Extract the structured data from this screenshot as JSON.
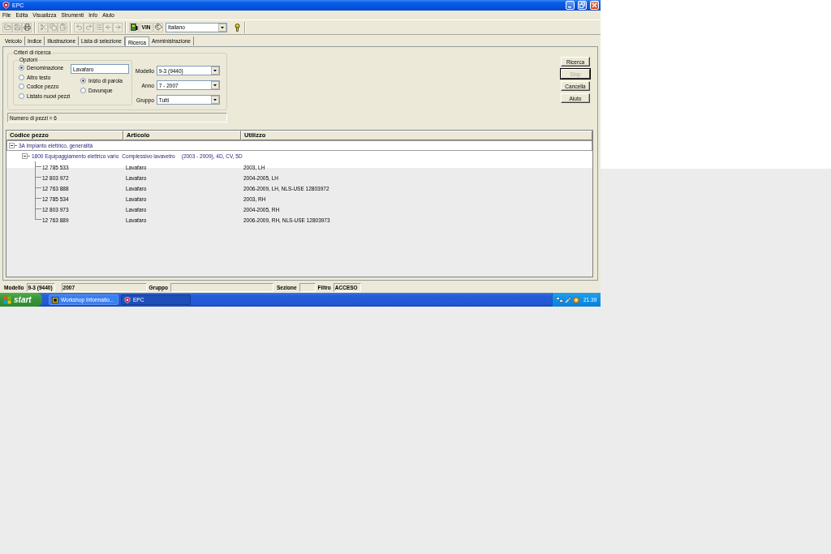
{
  "window": {
    "title": "EPC"
  },
  "menu": [
    "File",
    "Edita",
    "Visualizza",
    "Strumenti",
    "Info",
    "Aiuto"
  ],
  "toolbar": {
    "vin_label": "VIN",
    "language": "Italiano"
  },
  "tabs": [
    {
      "label": "Veicolo",
      "selected": false
    },
    {
      "label": "Indice",
      "selected": false
    },
    {
      "label": "Illustrazione",
      "selected": false
    },
    {
      "label": "Lista di selezione",
      "selected": false
    },
    {
      "label": "Ricerca",
      "selected": true
    },
    {
      "label": "Amministrazione",
      "selected": false
    }
  ],
  "search_criteria": {
    "title": "Criteri di ricerca",
    "options": {
      "title": "Opzioni",
      "search_by": [
        {
          "label": "Denominazione",
          "selected": true
        },
        {
          "label": "Altro testo",
          "selected": false
        },
        {
          "label": "Codice pezzo",
          "selected": false
        },
        {
          "label": "Listato nuovi pezzi",
          "selected": false
        }
      ],
      "text_value": "Lavafaro",
      "match": [
        {
          "label": "Inizio di parola",
          "selected": true
        },
        {
          "label": "Dovunque",
          "selected": false
        }
      ]
    },
    "filters": [
      {
        "label": "Modello",
        "value": "9-3 (9440)"
      },
      {
        "label": "Anno",
        "value": "7 - 2007"
      },
      {
        "label": "Gruppo",
        "value": "Tutti"
      }
    ],
    "result_count": "Numero di pezzi = 6"
  },
  "buttons": [
    {
      "label": "Ricerca",
      "disabled": false,
      "focused": false
    },
    {
      "label": "Stop",
      "disabled": true,
      "focused": true
    },
    {
      "label": "Cancella",
      "disabled": false,
      "focused": false
    },
    {
      "label": "Aiuto",
      "disabled": false,
      "focused": false
    }
  ],
  "table": {
    "columns": [
      "Codice pezzo",
      "Articolo",
      "Utilizzo"
    ],
    "tree": [
      {
        "kind": "group",
        "label": "3A Impianto elettrico, generalità",
        "expanded": true,
        "selected": true,
        "children": [
          {
            "kind": "group",
            "label": "1800 Equipaggiamento elettrico vario",
            "description": "Complessivo lavavetro",
            "detail": "(2003 - 2009), 4D, CV, 5D",
            "expanded": true,
            "selected": false,
            "children": [
              {
                "kind": "part",
                "code": "12 785 533",
                "article": "Lavafaro",
                "usage": "2003, LH",
                "selected": false
              },
              {
                "kind": "part",
                "code": "12 803 972",
                "article": "Lavafaro",
                "usage": "2004-2005, LH",
                "selected": false
              },
              {
                "kind": "part",
                "code": "12 763 888",
                "article": "Lavafaro",
                "usage": "2006-2009, LH, NLS-USE 12803972",
                "selected": false
              },
              {
                "kind": "part",
                "code": "12 785 534",
                "article": "Lavafaro",
                "usage": "2003, RH",
                "selected": false
              },
              {
                "kind": "part",
                "code": "12 803 973",
                "article": "Lavafaro",
                "usage": "2004-2005, RH",
                "selected": false
              },
              {
                "kind": "part",
                "code": "12 763 889",
                "article": "Lavafaro",
                "usage": "2006-2009, RH, NLS-USE 12803973",
                "selected": false
              }
            ]
          }
        ]
      }
    ]
  },
  "status_bar": [
    {
      "label": "Modello",
      "value": "9-3 (9440)"
    },
    {
      "value": "2007"
    },
    {
      "label": "Gruppo"
    },
    {
      "label": "Sezione"
    },
    {
      "label": "Filtro",
      "value": "ACCESO"
    }
  ],
  "taskbar": {
    "start_label": "start",
    "tasks": [
      {
        "label": "Workshop Informatio...",
        "selected": false
      },
      {
        "label": "EPC",
        "selected": true
      }
    ],
    "clock": "21.39"
  }
}
